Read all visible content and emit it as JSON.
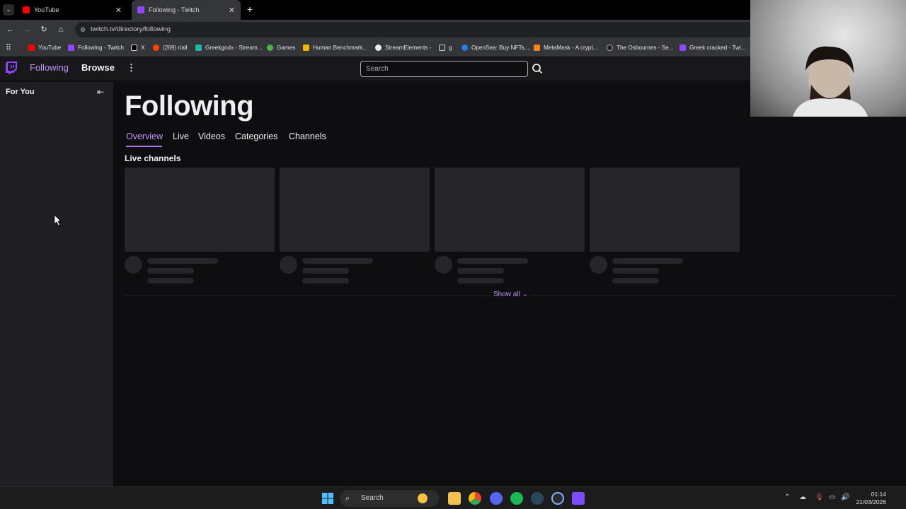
{
  "browser": {
    "tabs": [
      {
        "title": "YouTube",
        "active": false
      },
      {
        "title": "Following - Twitch",
        "active": true
      }
    ],
    "url": "twitch.tv/directory/following",
    "bookmarks": [
      "YouTube",
      "Following - Twitch",
      "X",
      "(269) r/all",
      "Greekgodx - Stream...",
      "Games",
      "Human Benchmark...",
      "StreamElements -",
      "g",
      "OpenSea: Buy NFTs,...",
      "MetaMask - A crypt...",
      "The Osbournes - Se...",
      "Greek cracked - Twi..."
    ]
  },
  "topnav": {
    "following": "Following",
    "browse": "Browse",
    "search_placeholder": "Search"
  },
  "sidebar": {
    "for_you": "For You"
  },
  "main": {
    "title": "Following",
    "tabs": [
      "Overview",
      "Live",
      "Videos",
      "Categories",
      "Channels"
    ],
    "active_tab": "Overview",
    "live_heading": "Live channels",
    "show_all": "Show all"
  },
  "taskbar": {
    "search": "Search",
    "time": "01:14",
    "date": "21/03/2026"
  },
  "colors": {
    "accent": "#a970ff",
    "link": "#bf94ff",
    "background": "#0e0e10",
    "sidebar": "#1f1f23",
    "skeleton": "#26262a"
  }
}
